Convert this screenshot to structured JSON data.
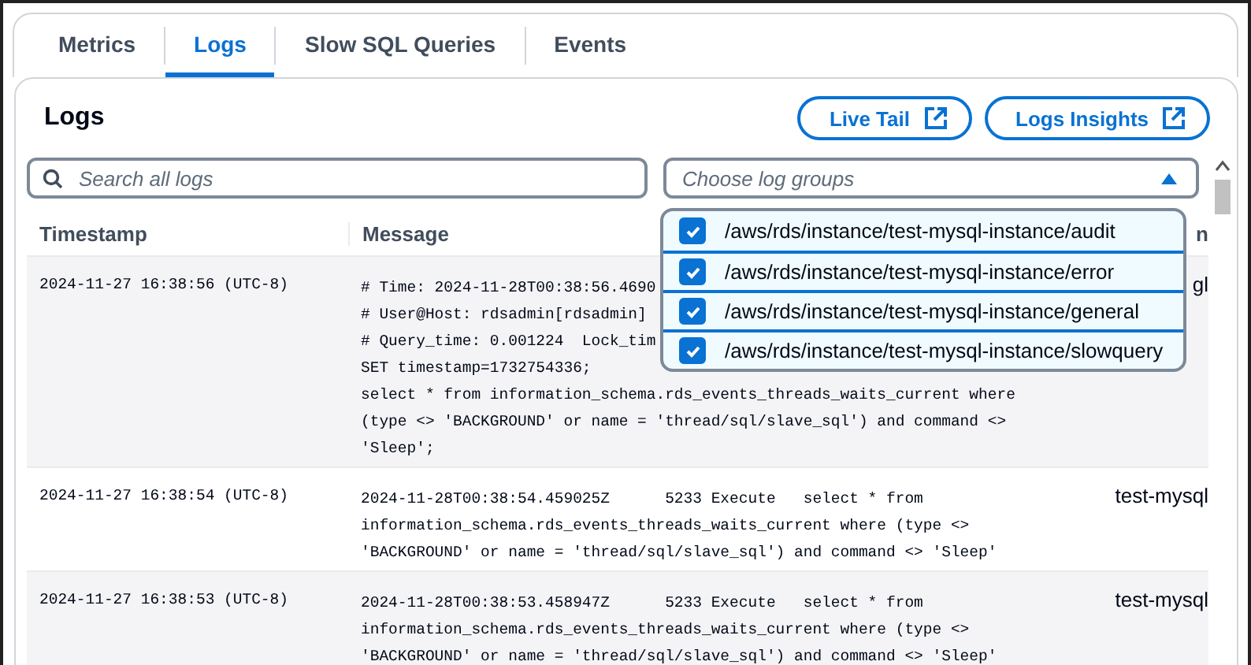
{
  "tabs": [
    {
      "label": "Metrics",
      "selected": false
    },
    {
      "label": "Logs",
      "selected": true
    },
    {
      "label": "Slow SQL Queries",
      "selected": false
    },
    {
      "label": "Events",
      "selected": false
    }
  ],
  "panel": {
    "title": "Logs",
    "buttons": [
      "Live Tail",
      "Logs Insights"
    ]
  },
  "search": {
    "placeholder": "Search all logs"
  },
  "log_groups": {
    "placeholder": "Choose log groups",
    "expanded": true,
    "options": [
      {
        "label": "/aws/rds/instance/test-mysql-instance/audit",
        "checked": true
      },
      {
        "label": "/aws/rds/instance/test-mysql-instance/error",
        "checked": true
      },
      {
        "label": "/aws/rds/instance/test-mysql-instance/general",
        "checked": true
      },
      {
        "label": "/aws/rds/instance/test-mysql-instance/slowquery",
        "checked": true
      }
    ]
  },
  "table": {
    "columns": [
      "Timestamp",
      "Message",
      "n"
    ],
    "rows": [
      {
        "timestamp": "2024-11-27 16:38:56 (UTC-8)",
        "message": [
          "# Time: 2024-11-28T00:38:56.4690",
          "# User@Host: rdsadmin[rdsadmin]",
          "# Query_time: 0.001224  Lock_tim",
          "SET timestamp=1732754336;",
          "select * from information_schema.rds_events_threads_waits_current where",
          "(type <> 'BACKGROUND' or name = 'thread/sql/slave_sql') and command <>",
          "'Sleep';"
        ],
        "column_3": "gl"
      },
      {
        "timestamp": "2024-11-27 16:38:54 (UTC-8)",
        "message": [
          "2024-11-28T00:38:54.459025Z      5233 Execute   select * from",
          "information_schema.rds_events_threads_waits_current where (type <>",
          "'BACKGROUND' or name = 'thread/sql/slave_sql') and command <> 'Sleep'"
        ],
        "column_3": "test-mysql"
      },
      {
        "timestamp": "2024-11-27 16:38:53 (UTC-8)",
        "message": [
          "2024-11-28T00:38:53.458947Z      5233 Execute   select * from",
          "information_schema.rds_events_threads_waits_current where (type <>",
          "'BACKGROUND' or name = 'thread/sql/slave_sql') and command <> 'Sleep'"
        ],
        "column_3": "test-mysql"
      }
    ]
  }
}
